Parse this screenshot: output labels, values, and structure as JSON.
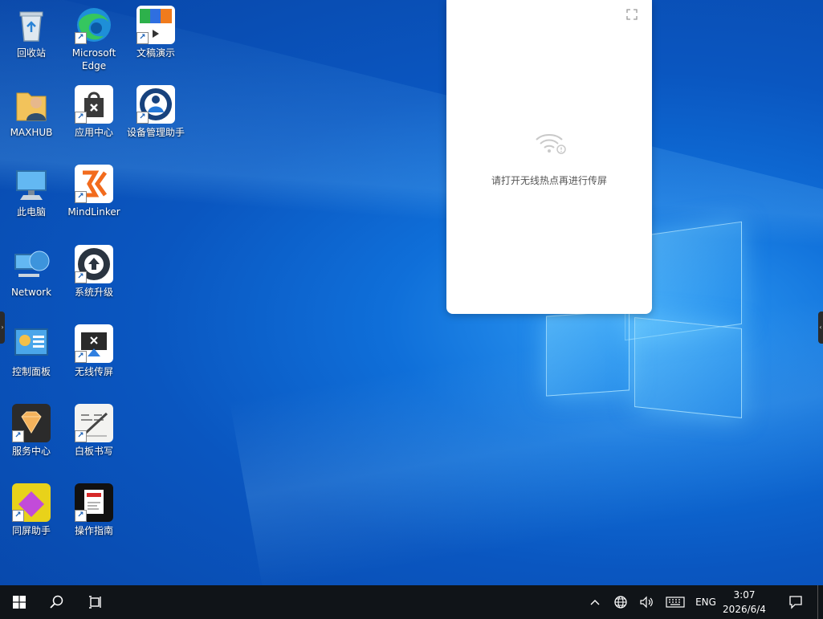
{
  "desktop": {
    "icons": [
      {
        "label": "回收站",
        "icon": "recycle-bin-icon"
      },
      {
        "label": "Microsoft Edge",
        "icon": "edge-icon"
      },
      {
        "label": "文稿演示",
        "icon": "slides-app-icon"
      },
      {
        "label": "MAXHUB",
        "icon": "user-folder-icon"
      },
      {
        "label": "应用中心",
        "icon": "app-center-icon"
      },
      {
        "label": "设备管理助手",
        "icon": "device-manager-icon"
      },
      {
        "label": "此电脑",
        "icon": "this-pc-icon"
      },
      {
        "label": "MindLinker",
        "icon": "mindlinker-icon"
      },
      {
        "label": "Network",
        "icon": "network-icon"
      },
      {
        "label": "系统升级",
        "icon": "system-upgrade-icon"
      },
      {
        "label": "控制面板",
        "icon": "control-panel-icon"
      },
      {
        "label": "无线传屏",
        "icon": "wireless-cast-icon"
      },
      {
        "label": "服务中心",
        "icon": "service-center-icon"
      },
      {
        "label": "白板书写",
        "icon": "whiteboard-icon"
      },
      {
        "label": "同屏助手",
        "icon": "screen-share-icon"
      },
      {
        "label": "操作指南",
        "icon": "guide-icon"
      }
    ]
  },
  "panel": {
    "message": "请打开无线热点再进行传屏"
  },
  "taskbar": {
    "language": "ENG",
    "time": "3:07",
    "date": "2026/6/4"
  },
  "colors": {
    "taskbar": "#101418",
    "desktop_accent": "#0a56c0"
  }
}
